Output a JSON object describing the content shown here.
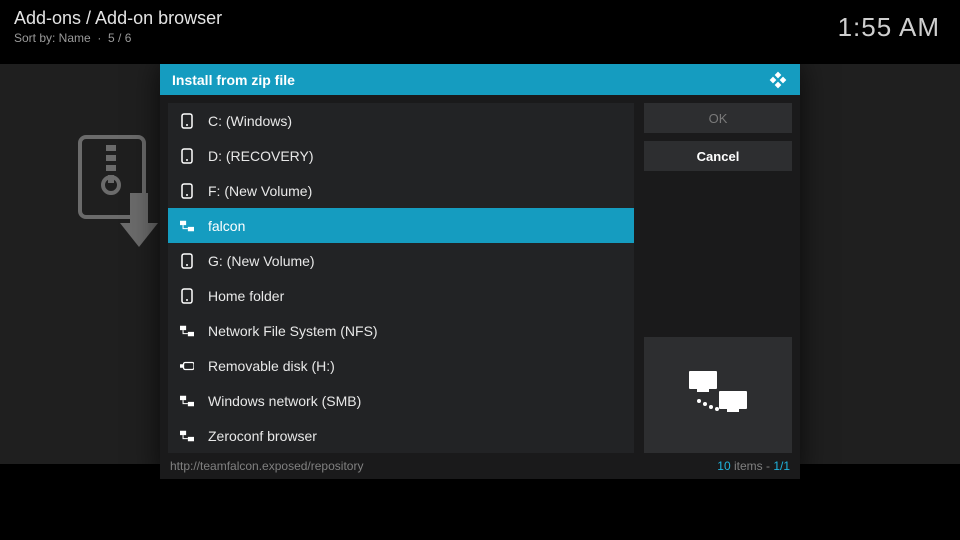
{
  "header": {
    "breadcrumb": "Add-ons / Add-on browser",
    "sort_label": "Sort by: Name",
    "position": "5 / 6"
  },
  "clock": "1:55 AM",
  "dialog": {
    "title": "Install from zip file",
    "items": [
      {
        "icon": "drive",
        "label": "C: (Windows)"
      },
      {
        "icon": "drive",
        "label": "D: (RECOVERY)"
      },
      {
        "icon": "drive",
        "label": "F: (New Volume)"
      },
      {
        "icon": "net",
        "label": "falcon",
        "selected": true
      },
      {
        "icon": "drive",
        "label": "G: (New Volume)"
      },
      {
        "icon": "drive",
        "label": "Home folder"
      },
      {
        "icon": "net",
        "label": "Network File System (NFS)"
      },
      {
        "icon": "usb",
        "label": "Removable disk (H:)"
      },
      {
        "icon": "net",
        "label": "Windows network (SMB)"
      },
      {
        "icon": "net",
        "label": "Zeroconf browser"
      }
    ],
    "buttons": {
      "ok": "OK",
      "cancel": "Cancel"
    },
    "footer": {
      "path": "http://teamfalcon.exposed/repository",
      "item_count": "10",
      "items_word": " items - ",
      "page": "1/1"
    }
  }
}
